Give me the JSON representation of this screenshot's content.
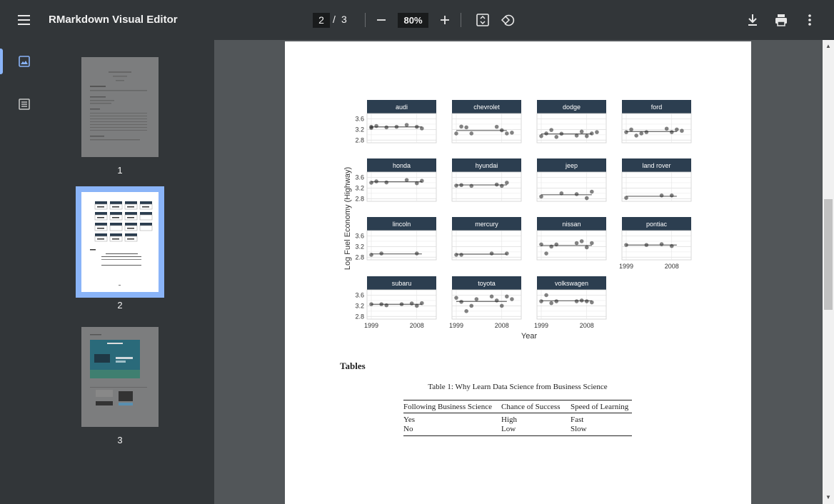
{
  "toolbar": {
    "title": "RMarkdown Visual Editor",
    "current_page": "2",
    "page_separator": "/",
    "total_pages": "3",
    "zoom": "80%"
  },
  "thumbnails": [
    {
      "label": "1"
    },
    {
      "label": "2"
    },
    {
      "label": "3"
    }
  ],
  "colors": {
    "toolbar_bg": "#323639",
    "viewer_bg": "#525659",
    "accent": "#8ab4f8",
    "facet_strip": "#2c3e50"
  },
  "chart_data": {
    "type": "scatter",
    "xlabel": "Year",
    "ylabel": "Log Fuel Economy (Highway)",
    "x_ticks": [
      "1999",
      "2008"
    ],
    "y_ticks": [
      "3.6",
      "3.2",
      "2.8"
    ],
    "x_range": [
      1999,
      2008
    ],
    "y_range": [
      2.7,
      3.8
    ],
    "panels": [
      {
        "name": "audi",
        "points": [
          [
            1999,
            3.3
          ],
          [
            1999,
            3.26
          ],
          [
            2000,
            3.33
          ],
          [
            2002,
            3.28
          ],
          [
            2004,
            3.3
          ],
          [
            2006,
            3.37
          ],
          [
            2008,
            3.3
          ],
          [
            2009,
            3.24
          ]
        ]
      },
      {
        "name": "chevrolet",
        "points": [
          [
            1999,
            3.05
          ],
          [
            2000,
            3.31
          ],
          [
            2001,
            3.28
          ],
          [
            2002,
            3.05
          ],
          [
            2007,
            3.3
          ],
          [
            2008,
            3.17
          ],
          [
            2009,
            3.05
          ],
          [
            2010,
            3.08
          ]
        ]
      },
      {
        "name": "dodge",
        "points": [
          [
            1999,
            2.95
          ],
          [
            2000,
            3.05
          ],
          [
            2001,
            3.18
          ],
          [
            2002,
            2.92
          ],
          [
            2003,
            3.04
          ],
          [
            2006,
            2.97
          ],
          [
            2007,
            3.12
          ],
          [
            2008,
            2.95
          ],
          [
            2009,
            3.05
          ],
          [
            2010,
            3.1
          ]
        ]
      },
      {
        "name": "ford",
        "points": [
          [
            1999,
            3.1
          ],
          [
            2000,
            3.2
          ],
          [
            2001,
            2.97
          ],
          [
            2002,
            3.05
          ],
          [
            2003,
            3.1
          ],
          [
            2007,
            3.23
          ],
          [
            2008,
            3.1
          ],
          [
            2009,
            3.2
          ],
          [
            2010,
            3.15
          ]
        ]
      },
      {
        "name": "honda",
        "points": [
          [
            1999,
            3.4
          ],
          [
            2000,
            3.45
          ],
          [
            2002,
            3.41
          ],
          [
            2006,
            3.5
          ],
          [
            2008,
            3.38
          ],
          [
            2009,
            3.47
          ]
        ]
      },
      {
        "name": "hyundai",
        "points": [
          [
            1999,
            3.29
          ],
          [
            2000,
            3.31
          ],
          [
            2002,
            3.28
          ],
          [
            2007,
            3.33
          ],
          [
            2008,
            3.28
          ],
          [
            2009,
            3.4
          ]
        ]
      },
      {
        "name": "jeep",
        "points": [
          [
            1999,
            2.88
          ],
          [
            2003,
            3.0
          ],
          [
            2006,
            2.97
          ],
          [
            2008,
            2.82
          ],
          [
            2009,
            3.06
          ]
        ]
      },
      {
        "name": "land rover",
        "points": [
          [
            1999,
            2.83
          ],
          [
            2006,
            2.92
          ],
          [
            2008,
            2.92
          ]
        ]
      },
      {
        "name": "lincoln",
        "points": [
          [
            1999,
            2.89
          ],
          [
            2001,
            2.94
          ],
          [
            2008,
            2.94
          ]
        ]
      },
      {
        "name": "mercury",
        "points": [
          [
            1999,
            2.89
          ],
          [
            2000,
            2.89
          ],
          [
            2006,
            2.94
          ],
          [
            2009,
            2.94
          ]
        ]
      },
      {
        "name": "nissan",
        "points": [
          [
            1999,
            3.28
          ],
          [
            2000,
            2.94
          ],
          [
            2001,
            3.2
          ],
          [
            2002,
            3.28
          ],
          [
            2006,
            3.33
          ],
          [
            2007,
            3.4
          ],
          [
            2008,
            3.17
          ],
          [
            2009,
            3.33
          ]
        ]
      },
      {
        "name": "pontiac",
        "points": [
          [
            1999,
            3.26
          ],
          [
            2003,
            3.26
          ],
          [
            2006,
            3.29
          ],
          [
            2008,
            3.22
          ]
        ]
      },
      {
        "name": "subaru",
        "points": [
          [
            1999,
            3.26
          ],
          [
            2001,
            3.26
          ],
          [
            2002,
            3.22
          ],
          [
            2005,
            3.26
          ],
          [
            2007,
            3.29
          ],
          [
            2008,
            3.2
          ],
          [
            2009,
            3.3
          ]
        ]
      },
      {
        "name": "toyota",
        "points": [
          [
            1999,
            3.5
          ],
          [
            2000,
            3.35
          ],
          [
            2001,
            3.0
          ],
          [
            2002,
            3.2
          ],
          [
            2003,
            3.45
          ],
          [
            2006,
            3.55
          ],
          [
            2007,
            3.4
          ],
          [
            2008,
            3.2
          ],
          [
            2009,
            3.55
          ],
          [
            2010,
            3.45
          ]
        ]
      },
      {
        "name": "volkswagen",
        "points": [
          [
            1999,
            3.37
          ],
          [
            2000,
            3.6
          ],
          [
            2001,
            3.3
          ],
          [
            2002,
            3.37
          ],
          [
            2006,
            3.37
          ],
          [
            2007,
            3.4
          ],
          [
            2008,
            3.37
          ],
          [
            2009,
            3.33
          ]
        ]
      }
    ]
  },
  "tables_section": {
    "heading": "Tables",
    "caption": "Table 1: Why Learn Data Science from Business Science",
    "columns": [
      "Following Business Science",
      "Chance of Success",
      "Speed of Learning"
    ],
    "rows": [
      [
        "Yes",
        "High",
        "Fast"
      ],
      [
        "No",
        "Low",
        "Slow"
      ]
    ]
  }
}
